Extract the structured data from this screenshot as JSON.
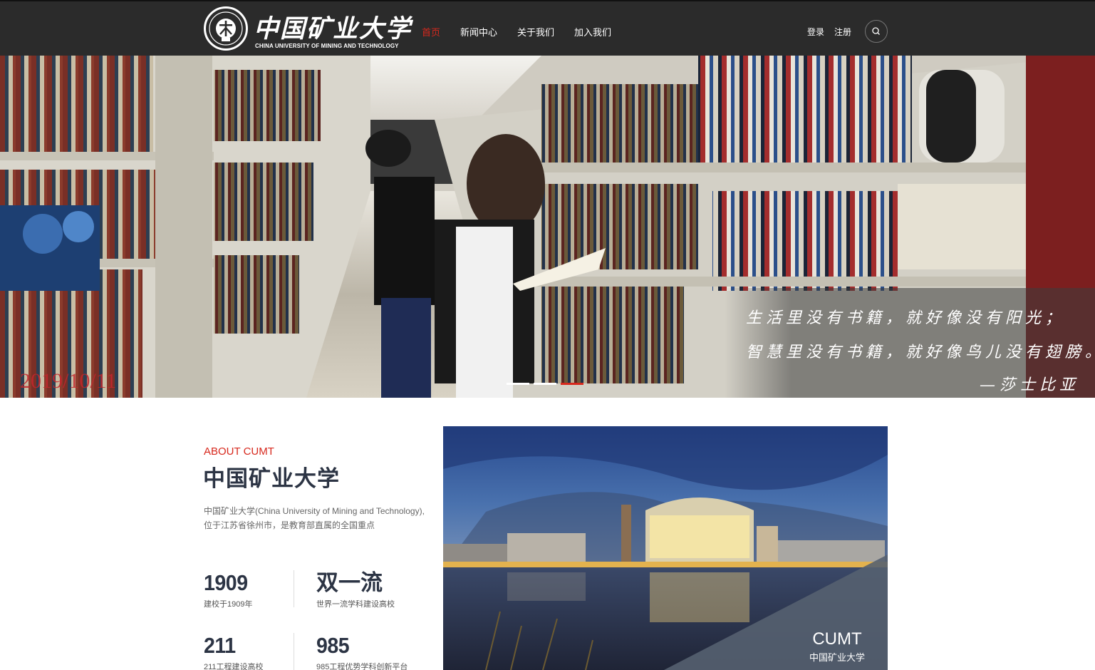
{
  "header": {
    "logo": {
      "name_cn": "中国矿业大学",
      "name_en": "CHINA UNIVERSITY OF MINING AND TECHNOLOGY",
      "seal_icon": "university-seal-icon"
    },
    "nav": [
      {
        "label": "首页",
        "active": true
      },
      {
        "label": "新闻中心",
        "active": false
      },
      {
        "label": "关于我们",
        "active": false
      },
      {
        "label": "加入我们",
        "active": false
      }
    ],
    "login_label": "登录",
    "register_label": "注册",
    "search_icon": "search-icon"
  },
  "banner": {
    "date": "2019/10/11",
    "quote": {
      "line1": "生活里没有书籍，就好像没有阳光；",
      "line2": "智慧里没有书籍，就好像鸟儿没有翅膀。",
      "author": "—莎士比亚"
    },
    "slides": 3,
    "active_slide": 3
  },
  "about": {
    "eyebrow": "ABOUT CUMT",
    "title": "中国矿业大学",
    "description": "中国矿业大学(China University of Mining and Technology),位于江苏省徐州市，是教育部直属的全国重点",
    "stats": [
      {
        "value": "1909",
        "label": "建校于1909年"
      },
      {
        "value": "双一流",
        "label": "世界一流学科建设高校"
      },
      {
        "value": "211",
        "label": "211工程建设高校"
      },
      {
        "value": "985",
        "label": "985工程优势学科创新平台"
      }
    ],
    "image_caption": {
      "en": "CUMT",
      "cn": "中国矿业大学"
    }
  },
  "colors": {
    "accent": "#d7281d",
    "header_bg": "#2b2b2b",
    "title": "#2c3444"
  }
}
